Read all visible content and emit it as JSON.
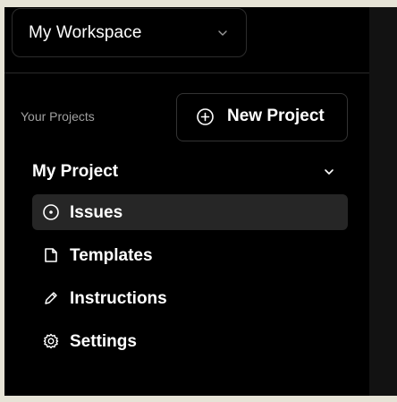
{
  "workspace": {
    "label": "My Workspace",
    "chevron_icon": "chevron-down-icon"
  },
  "projects": {
    "heading": "Your Projects",
    "new_project_label": "New Project",
    "new_project_icon": "plus-circle-icon"
  },
  "project": {
    "name": "My Project",
    "expanded": true,
    "chevron_icon": "chevron-down-icon"
  },
  "nav": {
    "items": [
      {
        "label": "Issues",
        "icon": "circle-dot-icon",
        "active": true
      },
      {
        "label": "Templates",
        "icon": "file-icon",
        "active": false
      },
      {
        "label": "Instructions",
        "icon": "pencil-icon",
        "active": false
      },
      {
        "label": "Settings",
        "icon": "gear-icon",
        "active": false
      }
    ]
  },
  "colors": {
    "sidebar_bg": "#000000",
    "active_item_bg": "#262626",
    "text": "#ffffff",
    "muted_text": "#a0a0a0",
    "border": "#2c2c2c",
    "outer_bg": "#e6e3d6"
  }
}
